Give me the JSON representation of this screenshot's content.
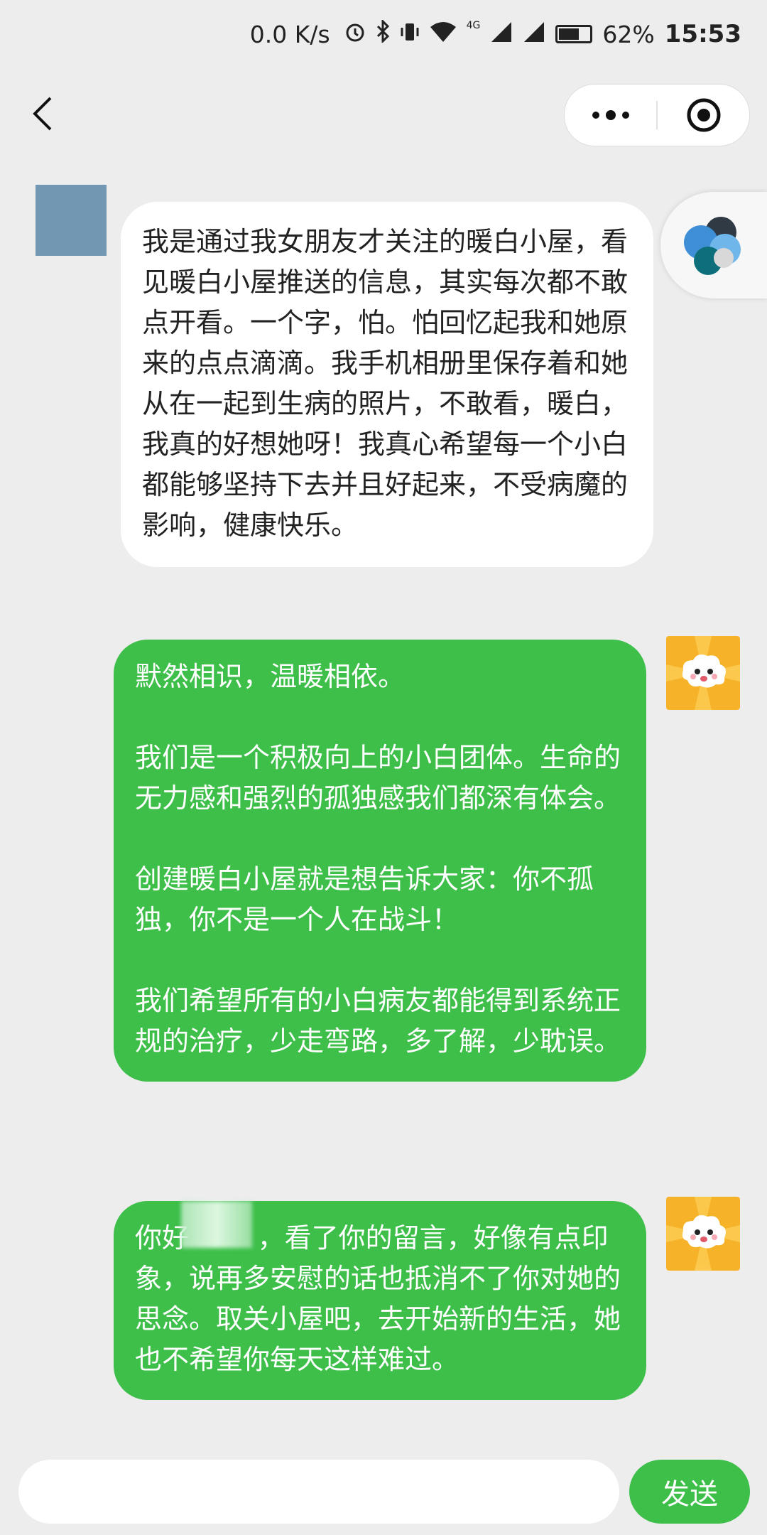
{
  "status_bar": {
    "net_speed": "0.0 K/s",
    "network": "4G",
    "battery": "62%",
    "time": "15:53"
  },
  "nav": {
    "back_icon": "chevron-left-icon",
    "more_icon": "more-dots-icon",
    "close_icon": "target-icon"
  },
  "messages": [
    {
      "side": "left",
      "text": "我是通过我女朋友才关注的暖白小屋，看见暖白小屋推送的信息，其实每次都不敢点开看。一个字，怕。怕回忆起我和她原来的点点滴滴。我手机相册里保存着和她从在一起到生病的照片，不敢看，暖白，我真的好想她呀！我真心希望每一个小白都能够坚持下去并且好起来，不受病魔的影响，健康快乐。"
    },
    {
      "side": "right",
      "text": "默然相识，温暖相依。\n\n我们是一个积极向上的小白团体。生命的无力感和强烈的孤独感我们都深有体会。\n\n创建暖白小屋就是想告诉大家：你不孤独，你不是一个人在战斗！\n\n我们希望所有的小白病友都能得到系统正规的治疗，少走弯路，多了解，少耽误。"
    },
    {
      "side": "right",
      "text": "你好        ，看了你的留言，好像有点印象，说再多安慰的话也抵消不了你对她的思念。取关小屋吧，去开始新的生活，她也不希望你每天这样难过。"
    }
  ],
  "input": {
    "placeholder": "",
    "send_label": "发送"
  },
  "colors": {
    "bubble_out": "#3dbf4a",
    "bubble_in": "#ffffff",
    "background": "#ededed",
    "user_avatar": "#7297b3",
    "bot_avatar": "#f6b32a"
  }
}
